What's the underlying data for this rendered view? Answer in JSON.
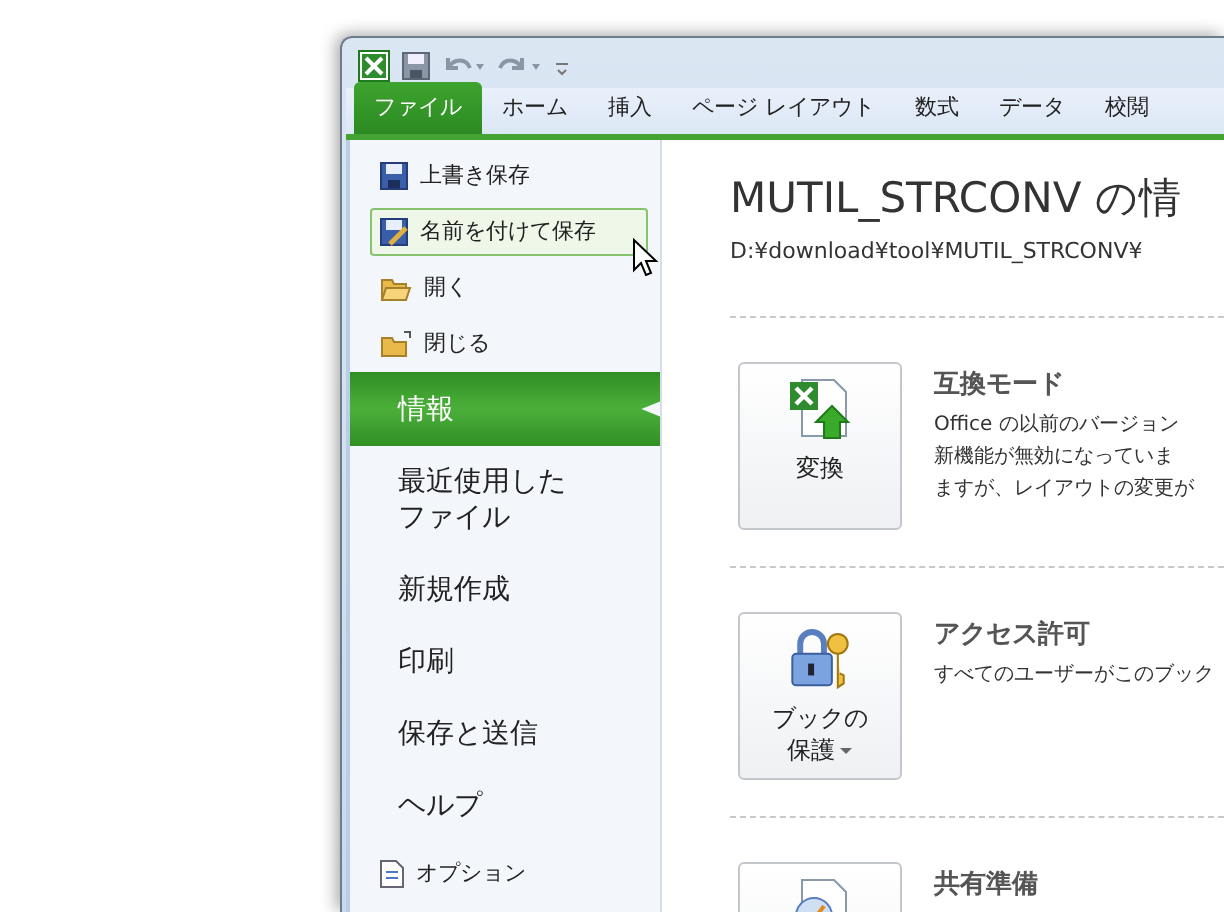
{
  "tabs": [
    {
      "label": "ファイル",
      "selected": true
    },
    {
      "label": "ホーム",
      "selected": false
    },
    {
      "label": "挿入",
      "selected": false
    },
    {
      "label": "ページ レイアウト",
      "selected": false
    },
    {
      "label": "数式",
      "selected": false
    },
    {
      "label": "データ",
      "selected": false
    },
    {
      "label": "校閲",
      "selected": false
    }
  ],
  "sidebar": {
    "items": [
      {
        "kind": "small",
        "label": "上書き保存",
        "selected": false,
        "hovered": false
      },
      {
        "kind": "small",
        "label": "名前を付けて保存",
        "selected": false,
        "hovered": true
      },
      {
        "kind": "small",
        "label": "開く",
        "selected": false,
        "hovered": false
      },
      {
        "kind": "small",
        "label": "閉じる",
        "selected": false,
        "hovered": false
      },
      {
        "kind": "large",
        "label": "情報",
        "selected": true
      },
      {
        "kind": "large",
        "label": "最近使用したファイル",
        "selected": false
      },
      {
        "kind": "large",
        "label": "新規作成",
        "selected": false
      },
      {
        "kind": "large",
        "label": "印刷",
        "selected": false
      },
      {
        "kind": "large",
        "label": "保存と送信",
        "selected": false
      },
      {
        "kind": "large",
        "label": "ヘルプ",
        "selected": false
      },
      {
        "kind": "small",
        "label": "オプション",
        "selected": false,
        "hovered": false
      }
    ]
  },
  "info": {
    "title": "MUTIL_STRCONV の情",
    "path": "D:¥download¥tool¥MUTIL_STRCONV¥",
    "sections": [
      {
        "button_label": "変換",
        "has_dropdown": false,
        "heading": "互換モード",
        "lines": [
          "Office の以前のバージョン",
          "新機能が無効になっていま",
          "ますが、レイアウトの変更が"
        ]
      },
      {
        "button_label": "ブックの保護",
        "has_dropdown": true,
        "heading": "アクセス許可",
        "lines": [
          "すべてのユーザーがこのブック"
        ]
      },
      {
        "heading": "共有準備"
      }
    ]
  }
}
